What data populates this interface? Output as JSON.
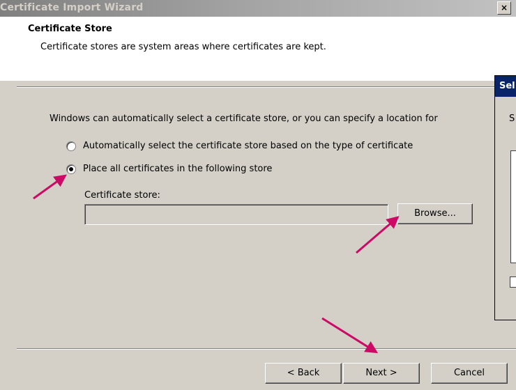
{
  "window": {
    "title": "Certificate Import Wizard",
    "close_label": "×"
  },
  "header": {
    "title": "Certificate Store",
    "subtitle": "Certificate stores are system areas where certificates are kept."
  },
  "body": {
    "instruction": "Windows can automatically select a certificate store, or you can specify a location for",
    "options": [
      {
        "label": "Automatically select the certificate store based on the type of certificate",
        "selected": false
      },
      {
        "label": "Place all certificates in the following store",
        "selected": true
      }
    ],
    "store_label": "Certificate store:",
    "store_value": "",
    "browse_label": "Browse..."
  },
  "footer": {
    "back_label": "< Back",
    "next_label": "Next >",
    "cancel_label": "Cancel"
  },
  "background_dialog": {
    "title_fragment": "Sel",
    "text_fragment": "S"
  },
  "annotation_color": "#cc0a66"
}
